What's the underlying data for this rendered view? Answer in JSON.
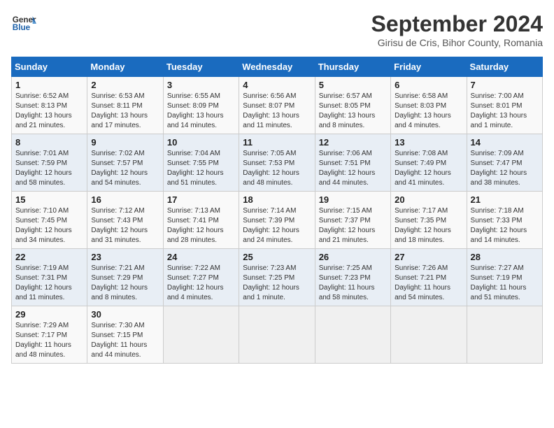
{
  "header": {
    "logo_line1": "General",
    "logo_line2": "Blue",
    "month": "September 2024",
    "location": "Girisu de Cris, Bihor County, Romania"
  },
  "weekdays": [
    "Sunday",
    "Monday",
    "Tuesday",
    "Wednesday",
    "Thursday",
    "Friday",
    "Saturday"
  ],
  "weeks": [
    [
      {
        "day": "1",
        "info": "Sunrise: 6:52 AM\nSunset: 8:13 PM\nDaylight: 13 hours and 21 minutes."
      },
      {
        "day": "2",
        "info": "Sunrise: 6:53 AM\nSunset: 8:11 PM\nDaylight: 13 hours and 17 minutes."
      },
      {
        "day": "3",
        "info": "Sunrise: 6:55 AM\nSunset: 8:09 PM\nDaylight: 13 hours and 14 minutes."
      },
      {
        "day": "4",
        "info": "Sunrise: 6:56 AM\nSunset: 8:07 PM\nDaylight: 13 hours and 11 minutes."
      },
      {
        "day": "5",
        "info": "Sunrise: 6:57 AM\nSunset: 8:05 PM\nDaylight: 13 hours and 8 minutes."
      },
      {
        "day": "6",
        "info": "Sunrise: 6:58 AM\nSunset: 8:03 PM\nDaylight: 13 hours and 4 minutes."
      },
      {
        "day": "7",
        "info": "Sunrise: 7:00 AM\nSunset: 8:01 PM\nDaylight: 13 hours and 1 minute."
      }
    ],
    [
      {
        "day": "8",
        "info": "Sunrise: 7:01 AM\nSunset: 7:59 PM\nDaylight: 12 hours and 58 minutes."
      },
      {
        "day": "9",
        "info": "Sunrise: 7:02 AM\nSunset: 7:57 PM\nDaylight: 12 hours and 54 minutes."
      },
      {
        "day": "10",
        "info": "Sunrise: 7:04 AM\nSunset: 7:55 PM\nDaylight: 12 hours and 51 minutes."
      },
      {
        "day": "11",
        "info": "Sunrise: 7:05 AM\nSunset: 7:53 PM\nDaylight: 12 hours and 48 minutes."
      },
      {
        "day": "12",
        "info": "Sunrise: 7:06 AM\nSunset: 7:51 PM\nDaylight: 12 hours and 44 minutes."
      },
      {
        "day": "13",
        "info": "Sunrise: 7:08 AM\nSunset: 7:49 PM\nDaylight: 12 hours and 41 minutes."
      },
      {
        "day": "14",
        "info": "Sunrise: 7:09 AM\nSunset: 7:47 PM\nDaylight: 12 hours and 38 minutes."
      }
    ],
    [
      {
        "day": "15",
        "info": "Sunrise: 7:10 AM\nSunset: 7:45 PM\nDaylight: 12 hours and 34 minutes."
      },
      {
        "day": "16",
        "info": "Sunrise: 7:12 AM\nSunset: 7:43 PM\nDaylight: 12 hours and 31 minutes."
      },
      {
        "day": "17",
        "info": "Sunrise: 7:13 AM\nSunset: 7:41 PM\nDaylight: 12 hours and 28 minutes."
      },
      {
        "day": "18",
        "info": "Sunrise: 7:14 AM\nSunset: 7:39 PM\nDaylight: 12 hours and 24 minutes."
      },
      {
        "day": "19",
        "info": "Sunrise: 7:15 AM\nSunset: 7:37 PM\nDaylight: 12 hours and 21 minutes."
      },
      {
        "day": "20",
        "info": "Sunrise: 7:17 AM\nSunset: 7:35 PM\nDaylight: 12 hours and 18 minutes."
      },
      {
        "day": "21",
        "info": "Sunrise: 7:18 AM\nSunset: 7:33 PM\nDaylight: 12 hours and 14 minutes."
      }
    ],
    [
      {
        "day": "22",
        "info": "Sunrise: 7:19 AM\nSunset: 7:31 PM\nDaylight: 12 hours and 11 minutes."
      },
      {
        "day": "23",
        "info": "Sunrise: 7:21 AM\nSunset: 7:29 PM\nDaylight: 12 hours and 8 minutes."
      },
      {
        "day": "24",
        "info": "Sunrise: 7:22 AM\nSunset: 7:27 PM\nDaylight: 12 hours and 4 minutes."
      },
      {
        "day": "25",
        "info": "Sunrise: 7:23 AM\nSunset: 7:25 PM\nDaylight: 12 hours and 1 minute."
      },
      {
        "day": "26",
        "info": "Sunrise: 7:25 AM\nSunset: 7:23 PM\nDaylight: 11 hours and 58 minutes."
      },
      {
        "day": "27",
        "info": "Sunrise: 7:26 AM\nSunset: 7:21 PM\nDaylight: 11 hours and 54 minutes."
      },
      {
        "day": "28",
        "info": "Sunrise: 7:27 AM\nSunset: 7:19 PM\nDaylight: 11 hours and 51 minutes."
      }
    ],
    [
      {
        "day": "29",
        "info": "Sunrise: 7:29 AM\nSunset: 7:17 PM\nDaylight: 11 hours and 48 minutes."
      },
      {
        "day": "30",
        "info": "Sunrise: 7:30 AM\nSunset: 7:15 PM\nDaylight: 11 hours and 44 minutes."
      },
      {
        "day": "",
        "info": ""
      },
      {
        "day": "",
        "info": ""
      },
      {
        "day": "",
        "info": ""
      },
      {
        "day": "",
        "info": ""
      },
      {
        "day": "",
        "info": ""
      }
    ]
  ]
}
